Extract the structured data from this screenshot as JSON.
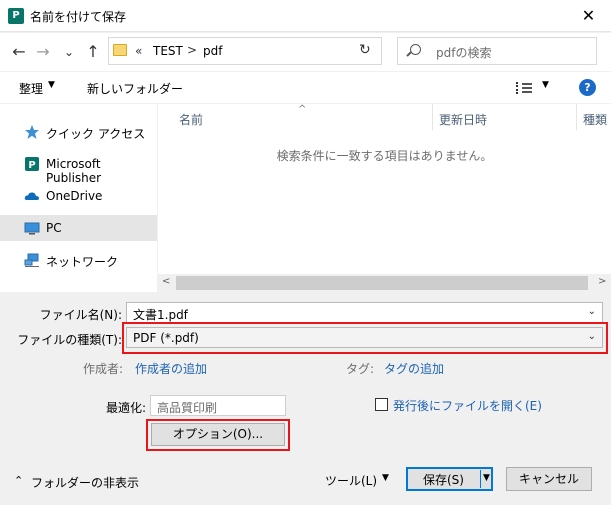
{
  "window": {
    "title": "名前を付けて保存",
    "app_icon": "P",
    "close": "✕"
  },
  "nav": {
    "back": "←",
    "forward": "→",
    "down": "⌄",
    "up": "↑",
    "breadcrumb_prefix": "«",
    "breadcrumb": [
      "TEST",
      "pdf"
    ],
    "separator": ">",
    "refresh": "↻",
    "search_placeholder": "pdfの検索"
  },
  "toolbar": {
    "organize": "整理",
    "new_folder": "新しいフォルダー",
    "help": "?"
  },
  "sidebar": {
    "items": [
      {
        "label": "クイック アクセス",
        "icon": "star-icon"
      },
      {
        "label": "Microsoft Publisher",
        "icon": "publisher-icon"
      },
      {
        "label": "OneDrive",
        "icon": "cloud-icon"
      },
      {
        "label": "PC",
        "icon": "pc-icon",
        "selected": true
      },
      {
        "label": "ネットワーク",
        "icon": "network-icon"
      }
    ]
  },
  "filelist": {
    "columns": [
      "名前",
      "更新日時",
      "種類"
    ],
    "empty_message": "検索条件に一致する項目はありません。"
  },
  "form": {
    "filename_label": "ファイル名(N):",
    "filename_value": "文書1.pdf",
    "filetype_label": "ファイルの種類(T):",
    "filetype_value": "PDF (*.pdf)",
    "author_label": "作成者:",
    "author_link": "作成者の追加",
    "tags_label": "タグ:",
    "tags_link": "タグの追加",
    "optimize_label": "最適化:",
    "optimize_value": "高品質印刷",
    "open_after_label": "発行後にファイルを開く(E)",
    "open_after_checked": false,
    "options_button": "オプション(O)..."
  },
  "footer": {
    "hide_folders": "フォルダーの非表示",
    "tools": "ツール(L)",
    "save": "保存(S)",
    "cancel": "キャンセル"
  },
  "colors": {
    "accent": "#0078d7",
    "highlight": "#e8151a",
    "link": "#1e62b2",
    "publisher": "#077568"
  }
}
